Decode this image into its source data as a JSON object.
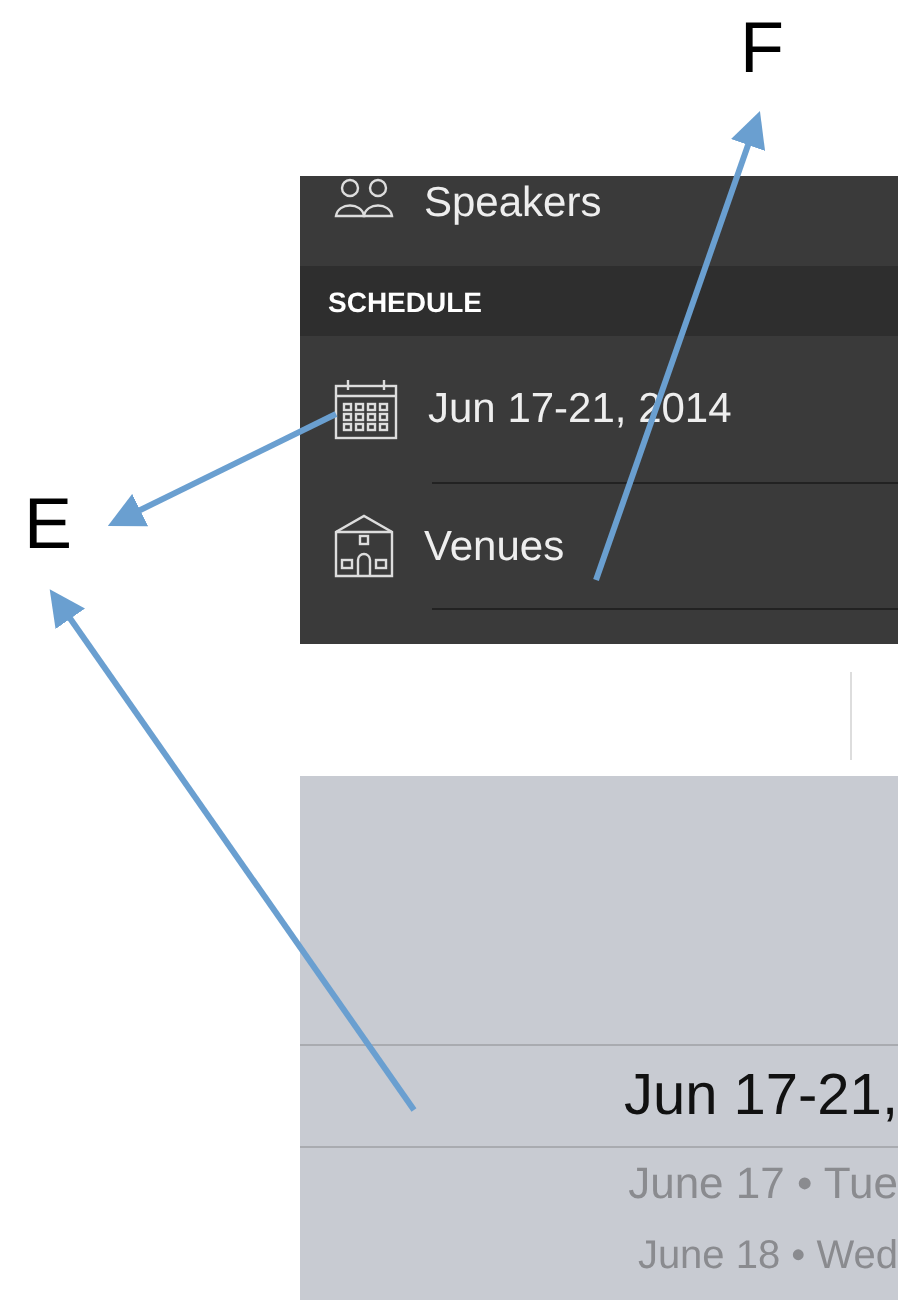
{
  "annotations": [
    {
      "label": "F"
    },
    {
      "label": "E"
    }
  ],
  "menu": {
    "items": [
      {
        "kind": "item",
        "label": "Speakers"
      },
      {
        "kind": "section",
        "label": "SCHEDULE"
      },
      {
        "kind": "item",
        "label": "Jun 17-21, 2014"
      },
      {
        "kind": "item",
        "label": "Venues"
      }
    ]
  },
  "date_picker": {
    "rows": [
      {
        "label": "Jun 17-21,",
        "selected": true
      },
      {
        "label": "June 17 • Tue",
        "selected": false
      },
      {
        "label": "June 18 • Wed",
        "selected": false
      }
    ]
  }
}
